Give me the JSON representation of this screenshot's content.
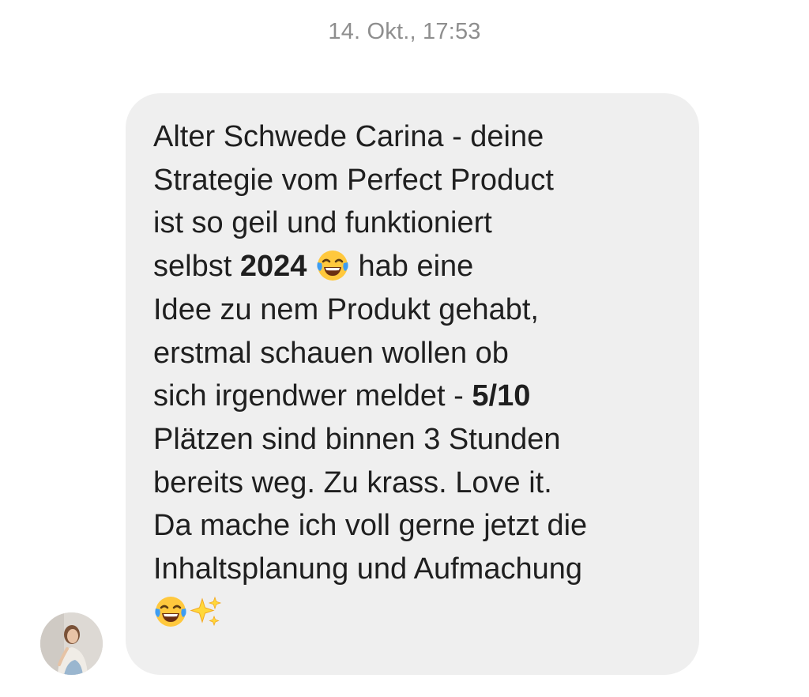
{
  "timestamp": "14. Okt., 17:53",
  "message": {
    "line1": "Alter Schwede Carina - deine",
    "line2": "Strategie vom Perfect Product",
    "line3": "ist so geil und funktioniert",
    "line4_pre": "selbst ",
    "line4_bold": "2024",
    "line4_post": " hab eine",
    "line5": "Idee zu nem Produkt gehabt,",
    "line6": "erstmal schauen wollen ob",
    "line7_pre": "sich irgendwer meldet - ",
    "line7_bold": "5/10",
    "line8": "Plätzen sind binnen 3 Stunden",
    "line9": "bereits weg. Zu krass. Love it.",
    "line10": "Da mache ich voll gerne jetzt die",
    "line11": "Inhaltsplanung und Aufmachung"
  },
  "icons": {
    "emoji_1": "face-with-tears-of-joy-emoji",
    "emoji_2": "face-with-tears-of-joy-emoji",
    "emoji_3": "sparkles-emoji",
    "avatar": "sender-avatar"
  },
  "colors": {
    "bubble_bg": "#efefef",
    "text": "#1f1f1f",
    "timestamp": "#8e8e8e",
    "emoji_face": "#ffc83d",
    "emoji_tears": "#3d9df3",
    "sparkles": "#ffd83b"
  }
}
